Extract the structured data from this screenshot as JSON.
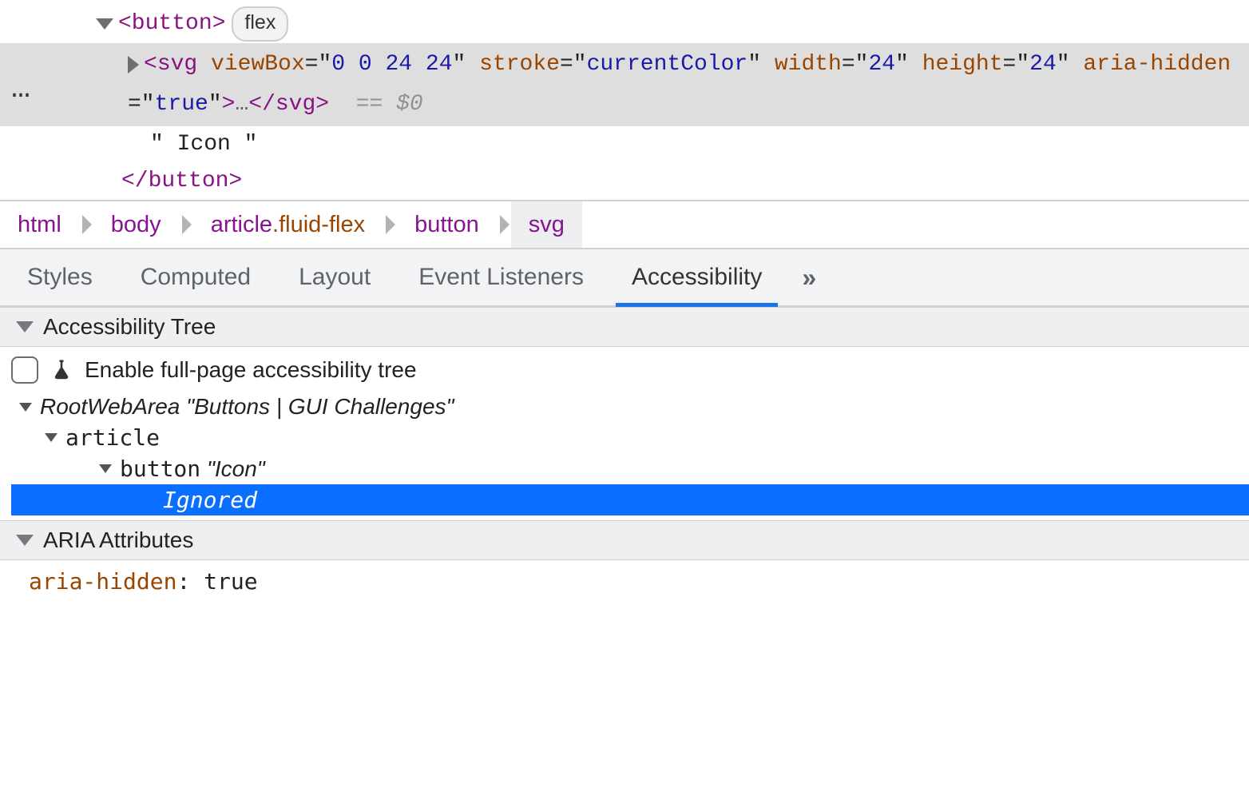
{
  "elements": {
    "button_open": "<button>",
    "button_close": "</button>",
    "flex_badge": "flex",
    "svg_tag": "svg",
    "svg_attrs": [
      {
        "name": "viewBox",
        "value": "0 0 24 24"
      },
      {
        "name": "stroke",
        "value": "currentColor"
      },
      {
        "name": "width",
        "value": "24"
      },
      {
        "name": "height",
        "value": "24"
      },
      {
        "name": "aria-hidden",
        "value": "true"
      }
    ],
    "svg_ellipsis": "…",
    "svg_close": "</svg>",
    "eq0": "== $0",
    "text_node": "\" Icon \""
  },
  "breadcrumb": {
    "items": [
      {
        "tag": "html",
        "cls": ""
      },
      {
        "tag": "body",
        "cls": ""
      },
      {
        "tag": "article",
        "cls": ".fluid-flex"
      },
      {
        "tag": "button",
        "cls": ""
      },
      {
        "tag": "svg",
        "cls": ""
      }
    ],
    "selected_index": 4
  },
  "tabs": {
    "items": [
      "Styles",
      "Computed",
      "Layout",
      "Event Listeners",
      "Accessibility"
    ],
    "active_index": 4,
    "more": "»"
  },
  "a11y": {
    "tree_header": "Accessibility Tree",
    "enable_label": "Enable full-page accessibility tree",
    "nodes": [
      {
        "depth": 0,
        "role": "RootWebArea",
        "name": "\"Buttons | GUI Challenges\"",
        "monoRole": false
      },
      {
        "depth": 1,
        "role": "article",
        "name": "",
        "monoRole": true
      },
      {
        "depth": 2,
        "role": "button",
        "name": "\"Icon\"",
        "monoRole": true
      },
      {
        "depth": 3,
        "role": "Ignored",
        "name": "",
        "monoRole": true,
        "selected": true
      }
    ],
    "aria_header": "ARIA Attributes",
    "aria_attr_name": "aria-hidden",
    "aria_attr_value": "true"
  }
}
